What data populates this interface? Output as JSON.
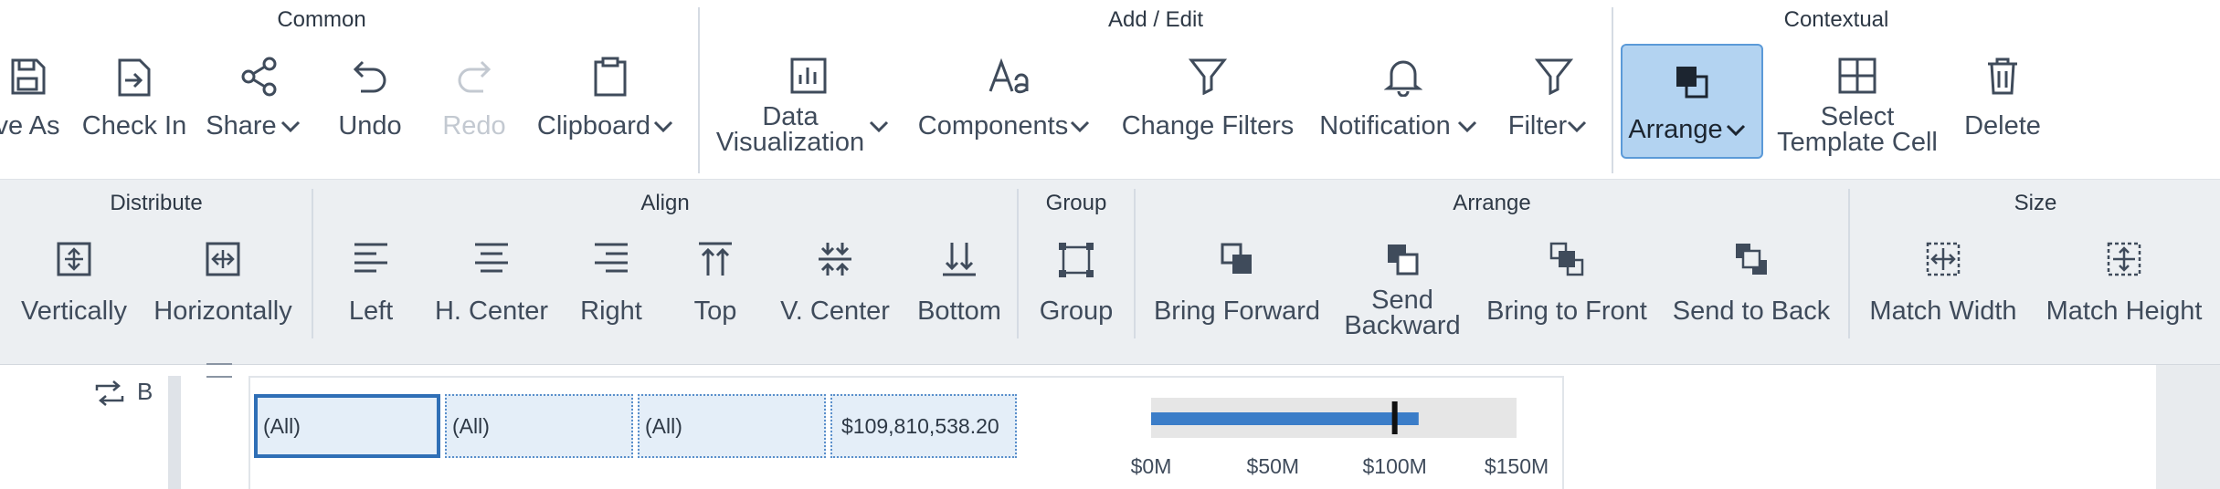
{
  "ribbon": {
    "groups": {
      "common": "Common",
      "add_edit": "Add / Edit",
      "contextual": "Contextual"
    },
    "buttons": {
      "save_as": "ve As",
      "check_in": "Check In",
      "share": "Share",
      "undo": "Undo",
      "redo": "Redo",
      "clipboard": "Clipboard",
      "data_vis_1": "Data",
      "data_vis_2": "Visualization",
      "components": "Components",
      "change_filters": "Change Filters",
      "notification": "Notification",
      "filter": "Filter",
      "arrange": "Arrange",
      "select_1": "Select",
      "select_2": "Template Cell",
      "delete": "Delete"
    }
  },
  "subribbon": {
    "groups": {
      "distribute": "Distribute",
      "align": "Align",
      "group": "Group",
      "arrange": "Arrange",
      "size": "Size"
    },
    "buttons": {
      "vertically": "Vertically",
      "horizontally": "Horizontally",
      "left": "Left",
      "h_center": "H. Center",
      "right": "Right",
      "top": "Top",
      "v_center": "V. Center",
      "bottom": "Bottom",
      "group": "Group",
      "bring_forward": "Bring Forward",
      "send_backward_1": "Send",
      "send_backward_2": "Backward",
      "bring_to_front": "Bring to Front",
      "send_to_back": "Send to Back",
      "match_width": "Match Width",
      "match_height": "Match Height"
    }
  },
  "canvas": {
    "row_label": "B",
    "cells": [
      "(All)",
      "(All)",
      "(All)",
      "$109,810,538.20"
    ],
    "bullet": {
      "value": 109810538.2,
      "target": 100000000,
      "max": 150000000,
      "ticks": [
        "$0M",
        "$50M",
        "$100M",
        "$150M"
      ]
    }
  },
  "colors": {
    "accent": "#b3d3f1",
    "accent_border": "#5b9ad8",
    "bar": "#3b7dc8",
    "bar_bg": "#e6e6e6"
  }
}
